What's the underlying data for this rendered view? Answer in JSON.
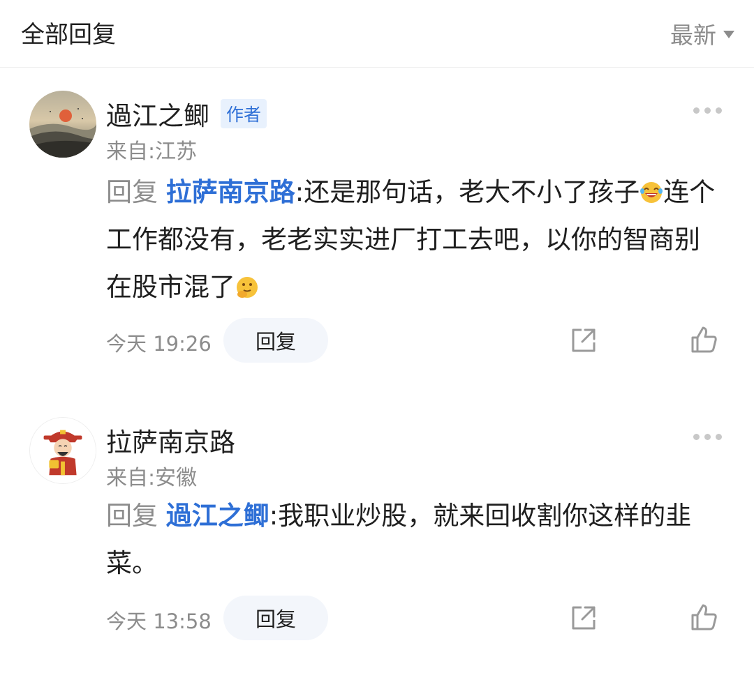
{
  "header": {
    "title": "全部回复",
    "sort_label": "最新"
  },
  "comments": [
    {
      "author": "過江之鲫",
      "badge": "作者",
      "location": "来自:江苏",
      "reply_prefix": "回复",
      "mention": "拉萨南京路",
      "colon": ":",
      "text_part1": "还是那句话，老大不小了孩子",
      "text_part2": "连个工作都没有，老老实实进厂打工去吧，以你的智商别在股市混了",
      "emojis": [
        "laughing-tears-emoji",
        "thinking-emoji"
      ],
      "time": "今天 19:26",
      "reply_button": "回复"
    },
    {
      "author": "拉萨南京路",
      "location": "来自:安徽",
      "reply_prefix": "回复",
      "mention": "過江之鲫",
      "colon": ":",
      "text": "我职业炒股，就来回收割你这样的韭菜。",
      "time": "今天 13:58",
      "reply_button": "回复"
    }
  ],
  "colors": {
    "accent": "#2e6fd6",
    "text_primary": "#1f1f1f",
    "text_secondary": "#8c8c8c",
    "badge_bg": "#e8f1fd",
    "button_bg": "#f3f6fb"
  }
}
